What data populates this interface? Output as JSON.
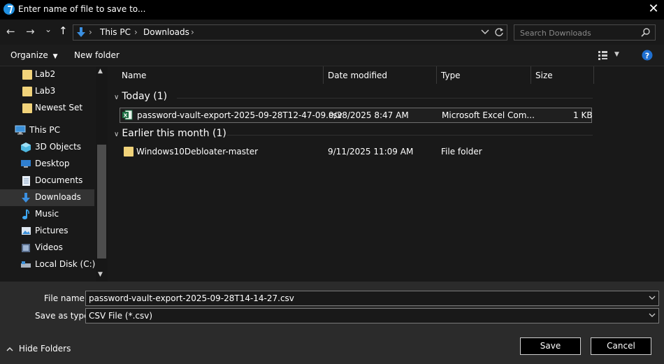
{
  "window": {
    "title": "Enter name of file to save to...",
    "close_glyph": "✕"
  },
  "nav": {
    "back": "←",
    "forward": "→",
    "recent": "⌄",
    "up": "↑",
    "breadcrumb": [
      "This PC",
      "Downloads"
    ],
    "separator": "›",
    "search_placeholder": "Search Downloads"
  },
  "toolbar": {
    "organize_label": "Organize",
    "new_folder_label": "New folder"
  },
  "sidebar": {
    "items": [
      {
        "label": "Lab2",
        "icon": "folder-icon"
      },
      {
        "label": "Lab3",
        "icon": "folder-icon"
      },
      {
        "label": "Newest Set",
        "icon": "folder-icon"
      },
      {
        "label": "This PC",
        "icon": "this-pc-icon"
      },
      {
        "label": "3D Objects",
        "icon": "3d-objects-icon"
      },
      {
        "label": "Desktop",
        "icon": "desktop-icon"
      },
      {
        "label": "Documents",
        "icon": "documents-icon"
      },
      {
        "label": "Downloads",
        "icon": "downloads-icon"
      },
      {
        "label": "Music",
        "icon": "music-icon"
      },
      {
        "label": "Pictures",
        "icon": "pictures-icon"
      },
      {
        "label": "Videos",
        "icon": "videos-icon"
      },
      {
        "label": "Local Disk (C:)",
        "icon": "drive-icon"
      }
    ]
  },
  "columns": {
    "name": "Name",
    "date": "Date modified",
    "type": "Type",
    "size": "Size"
  },
  "groups": [
    {
      "label": "Today (1)",
      "rows": [
        {
          "name": "password-vault-export-2025-09-28T12-47-09.csv",
          "date": "9/28/2025 8:47 AM",
          "type": "Microsoft Excel Com...",
          "size": "1 KB"
        }
      ]
    },
    {
      "label": "Earlier this month (1)",
      "rows": [
        {
          "name": "Windows10Debloater-master",
          "date": "9/11/2025 11:09 AM",
          "type": "File folder",
          "size": ""
        }
      ]
    }
  ],
  "bottom": {
    "file_name_label": "File name:",
    "file_name_value": "password-vault-export-2025-09-28T14-14-27.csv",
    "save_type_label": "Save as type:",
    "save_type_value": "CSV File (*.csv)",
    "hide_folders_label": "Hide Folders",
    "save_label": "Save",
    "cancel_label": "Cancel"
  },
  "colors": {
    "accent": "#1f8fe0",
    "background": "#191919",
    "folder": "#f1d37a",
    "excel": "#1d7044"
  }
}
